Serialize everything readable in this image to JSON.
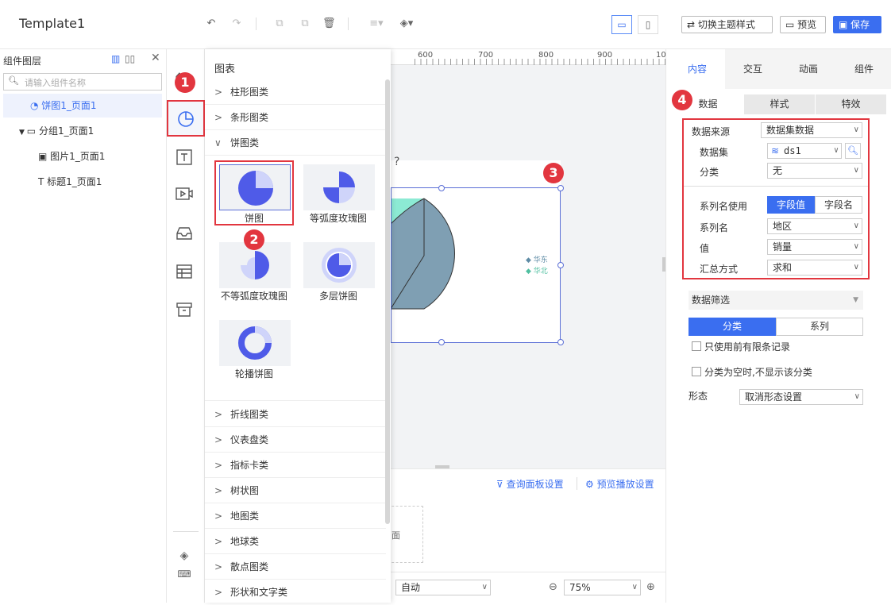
{
  "app": {
    "title": "Template1"
  },
  "toolbar": {
    "switch_theme": "切换主题样式",
    "preview": "预览",
    "save": "保存"
  },
  "layers": {
    "title": "组件图层",
    "search_placeholder": "请输入组件名称",
    "items": [
      {
        "label": "饼图1_页面1"
      },
      {
        "label": "分组1_页面1"
      },
      {
        "label": "图片1_页面1"
      },
      {
        "label": "标题1_页面1"
      }
    ]
  },
  "dropdown": {
    "title": "图表",
    "categories_top": [
      "柱形图类",
      "条形图类",
      "饼图类"
    ],
    "pie_items": [
      "饼图",
      "等弧度玫瑰图",
      "不等弧度玫瑰图",
      "多层饼图",
      "轮播饼图"
    ],
    "categories_bottom": [
      "折线图类",
      "仪表盘类",
      "指标卡类",
      "树状图",
      "地图类",
      "地球类",
      "散点图类",
      "形状和文字类"
    ]
  },
  "ruler": {
    "ticks": [
      "600",
      "700",
      "800",
      "900",
      "10"
    ]
  },
  "canvas": {
    "legend": [
      "华东",
      "华北"
    ],
    "colors": {
      "series1": "#7f9fb3",
      "series2": "#7fe8cf",
      "selection": "#5b6fd6"
    }
  },
  "bottom": {
    "query_settings": "查询面板设置",
    "preview_settings": "预览播放设置",
    "placeholder_fragment": "面"
  },
  "status": {
    "auto": "自动",
    "zoom": "75%"
  },
  "right": {
    "tabs": [
      "内容",
      "交互",
      "动画",
      "组件"
    ],
    "subtabs": [
      "数据",
      "样式",
      "特效"
    ],
    "data_source_label": "数据来源",
    "data_source_value": "数据集数据",
    "dataset_label": "数据集",
    "dataset_value": "ds1",
    "category_label": "分类",
    "category_value": "无",
    "series_name_use_label": "系列名使用",
    "series_name_use_options": [
      "字段值",
      "字段名"
    ],
    "series_name_label": "系列名",
    "series_name_value": "地区",
    "value_label": "值",
    "value_value": "销量",
    "summary_label": "汇总方式",
    "summary_value": "求和",
    "filter_label": "数据筛选",
    "filter_tabs": [
      "分类",
      "系列"
    ],
    "limit_records": "只使用前有限条记录",
    "hide_empty": "分类为空时,不显示该分类",
    "shape_label": "形态",
    "shape_value": "取消形态设置"
  },
  "annotations": {
    "badge1": "1",
    "badge2": "2",
    "badge3": "3",
    "badge4": "4"
  }
}
